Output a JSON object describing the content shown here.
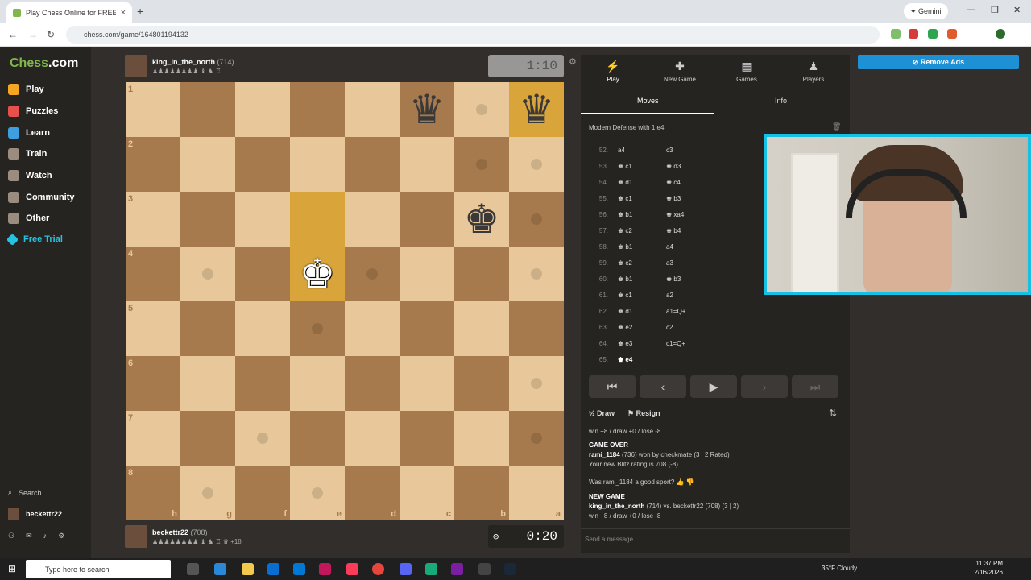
{
  "browser": {
    "tab_title": "Play Chess Online for FREE",
    "url": "chess.com/game/164801194132",
    "gemini": "Gemini"
  },
  "sidebar": {
    "logo_main": "Chess",
    "logo_suffix": ".com",
    "items": [
      {
        "label": "Play",
        "color": "#f5a623"
      },
      {
        "label": "Puzzles",
        "color": "#e8504c"
      },
      {
        "label": "Learn",
        "color": "#3e9ee0"
      },
      {
        "label": "Train",
        "color": "#9a8c7e"
      },
      {
        "label": "Watch",
        "color": "#9a8c7e"
      },
      {
        "label": "Community",
        "color": "#9a8c7e"
      },
      {
        "label": "Other",
        "color": "#9a8c7e"
      },
      {
        "label": "Free Trial",
        "color": "#26c2e3"
      }
    ],
    "search": "Search",
    "user": "beckettr22"
  },
  "top_player": {
    "name": "king_in_the_north",
    "rating": "(714)",
    "captures": "♟♟♟♟♟♟♟♟ ♝ ♞ ♖"
  },
  "top_clock": "1:10",
  "bottom_player": {
    "name": "beckettr22",
    "rating": "(708)",
    "captures": "♟♟♟♟♟♟♟♟ ♝ ♞ ♖ ♛",
    "advantage": "+18"
  },
  "bottom_clock": "0:20",
  "board": {
    "ranks": [
      "1",
      "2",
      "3",
      "4",
      "5",
      "6",
      "7",
      "8"
    ],
    "files": [
      "h",
      "g",
      "f",
      "e",
      "d",
      "c",
      "b",
      "a"
    ],
    "pieces": [
      {
        "row": 0,
        "col": 5,
        "piece": "queen",
        "color": "black",
        "glyph": "♛"
      },
      {
        "row": 0,
        "col": 7,
        "piece": "queen",
        "color": "black",
        "glyph": "♛"
      },
      {
        "row": 2,
        "col": 6,
        "piece": "king",
        "color": "black",
        "glyph": "♚"
      },
      {
        "row": 3,
        "col": 3,
        "piece": "king",
        "color": "white",
        "glyph": "♚"
      }
    ],
    "highlights": [
      [
        0,
        7
      ],
      [
        2,
        3
      ],
      [
        3,
        3
      ]
    ],
    "hints": [
      [
        0,
        6
      ],
      [
        1,
        6
      ],
      [
        1,
        7
      ],
      [
        2,
        7
      ],
      [
        3,
        1
      ],
      [
        3,
        4
      ],
      [
        3,
        7
      ],
      [
        4,
        3
      ],
      [
        6,
        2
      ],
      [
        6,
        7
      ],
      [
        7,
        1
      ],
      [
        7,
        3
      ],
      [
        8,
        0
      ],
      [
        5,
        7
      ]
    ]
  },
  "panel": {
    "top_tabs": [
      {
        "label": "Play",
        "icon": "⚡"
      },
      {
        "label": "New Game",
        "icon": "✚"
      },
      {
        "label": "Games",
        "icon": "▦"
      },
      {
        "label": "Players",
        "icon": "♟"
      }
    ],
    "sub_tabs": [
      "Moves",
      "Info"
    ],
    "opening": "Modern Defense with 1.e4",
    "moves": [
      {
        "n": "52.",
        "w": "a4",
        "b": "c3"
      },
      {
        "n": "53.",
        "w": "♚ c1",
        "b": "♚ d3"
      },
      {
        "n": "54.",
        "w": "♚ d1",
        "b": "♚ c4"
      },
      {
        "n": "55.",
        "w": "♚ c1",
        "b": "♚ b3"
      },
      {
        "n": "56.",
        "w": "♚ b1",
        "b": "♚ xa4"
      },
      {
        "n": "57.",
        "w": "♚ c2",
        "b": "♚ b4"
      },
      {
        "n": "58.",
        "w": "♚ b1",
        "b": "a4"
      },
      {
        "n": "59.",
        "w": "♚ c2",
        "b": "a3"
      },
      {
        "n": "60.",
        "w": "♚ b1",
        "b": "♚ b3"
      },
      {
        "n": "61.",
        "w": "♚ c1",
        "b": "a2"
      },
      {
        "n": "62.",
        "w": "♚ d1",
        "b": "a1=Q+"
      },
      {
        "n": "63.",
        "w": "♚ e2",
        "b": "c2"
      },
      {
        "n": "64.",
        "w": "♚ e3",
        "b": "c1=Q+"
      },
      {
        "n": "65.",
        "w": "♚ e4",
        "b": ""
      }
    ],
    "controls": [
      "⏮",
      "‹",
      "▶",
      "›",
      "⏭"
    ],
    "draw": "Draw",
    "resign": "Resign",
    "chat": {
      "line1": "win +8 / draw +0 / lose -8",
      "game_over": "GAME OVER",
      "result_name": "rami_1184",
      "result_text": "(736) won by checkmate (3 | 2 Rated)",
      "rating_line": "Your new Blitz rating is 708 (-8).",
      "good_sport": "Was rami_1184 a good sport?",
      "new_game": "NEW GAME",
      "match_white": "king_in_the_north",
      "match_rest": "(714) vs. beckettr22 (708) (3 | 2)",
      "line_last": "win +8 / draw +0 / lose -8"
    },
    "message_placeholder": "Send a message..."
  },
  "remove_ads": "Remove Ads",
  "taskbar": {
    "search": "Type here to search",
    "weather": "35°F  Cloudy",
    "time": "11:37 PM",
    "date": "2/16/2026"
  }
}
